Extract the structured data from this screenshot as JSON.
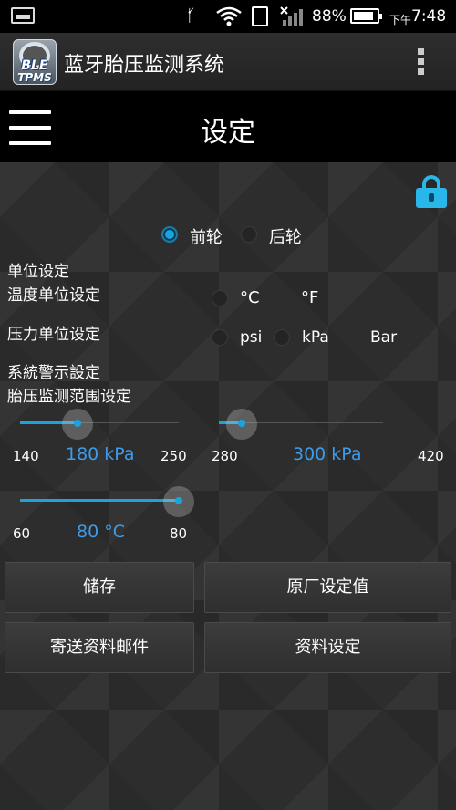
{
  "status_bar": {
    "battery": "88%",
    "time_period": "下午",
    "time": "7:48",
    "battery_level": 0.88
  },
  "app_bar": {
    "logo_line1": "BLE",
    "logo_line2": "TPMS",
    "title": "蓝牙胎压监测系统"
  },
  "header": {
    "title": "设定"
  },
  "wheel_select": {
    "front_label": "前轮",
    "rear_label": "后轮",
    "selected": "front"
  },
  "unit_settings": {
    "heading": "单位设定",
    "temp_label": "温度单位设定",
    "temp_c": "°C",
    "temp_f": "°F",
    "pressure_label": "压力单位设定",
    "psi": "psi",
    "kpa": "kPa",
    "bar": "Bar"
  },
  "alarm_settings": {
    "heading": "系統警示設定",
    "range_label": "胎压监测范围设定"
  },
  "sliders": {
    "low_pressure": {
      "min": "140",
      "max": "250",
      "value": "180 kPa",
      "fraction": 0.36
    },
    "high_pressure": {
      "min": "280",
      "max": "420",
      "value": "300 kPa",
      "fraction": 0.14
    },
    "temperature": {
      "min": "60",
      "max": "80",
      "value": "80 °C",
      "fraction": 1.0
    }
  },
  "buttons": {
    "save": "储存",
    "factory_default": "原厂设定值",
    "send_email": "寄送资料邮件",
    "data_settings": "资料设定"
  },
  "colors": {
    "accent": "#1aa4de",
    "value_text": "#3d9be9",
    "lock": "#29b6e8"
  },
  "icons": {
    "lock": "lock-icon",
    "menu": "hamburger-menu-icon",
    "overflow": "overflow-menu-icon"
  }
}
